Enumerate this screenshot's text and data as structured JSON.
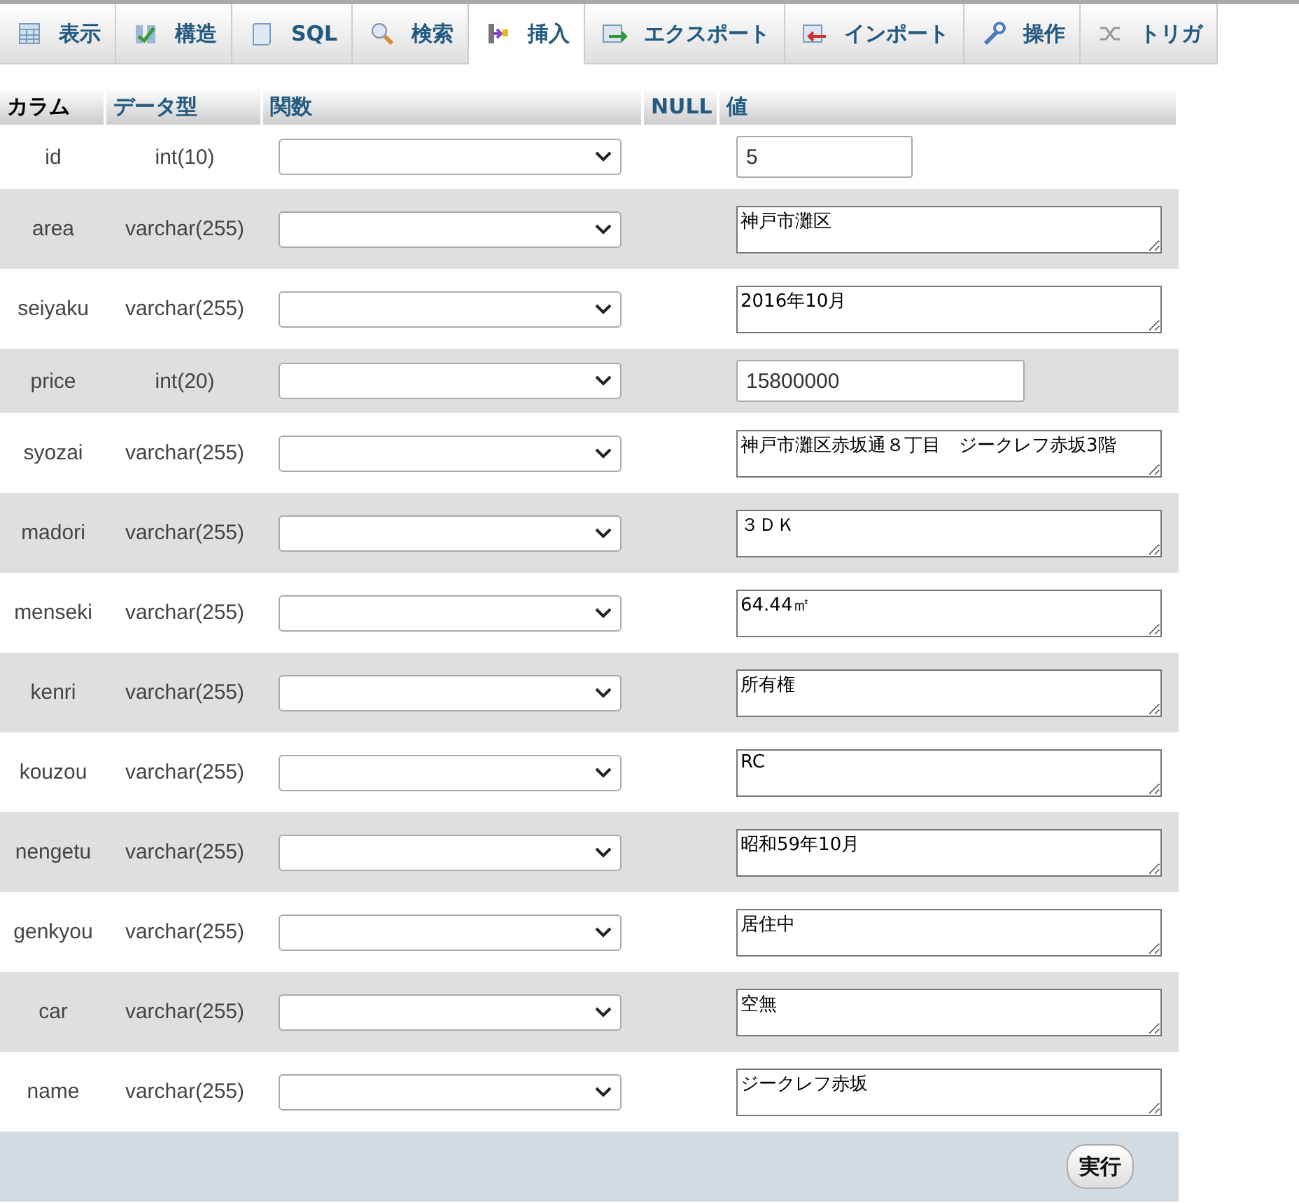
{
  "tabs": [
    {
      "label": "表示",
      "selected": false
    },
    {
      "label": "構造",
      "selected": false
    },
    {
      "label": "SQL",
      "selected": false
    },
    {
      "label": "検索",
      "selected": false
    },
    {
      "label": "挿入",
      "selected": true
    },
    {
      "label": "エクスポート",
      "selected": false
    },
    {
      "label": "インポート",
      "selected": false
    },
    {
      "label": "操作",
      "selected": false
    },
    {
      "label": "トリガ",
      "selected": false
    }
  ],
  "table": {
    "columns": [
      "カラム",
      "データ型",
      "関数",
      "NULL",
      "値"
    ],
    "rows": [
      {
        "column": "id",
        "type": "int(10)",
        "kind": "input",
        "value": "5"
      },
      {
        "column": "area",
        "type": "varchar(255)",
        "kind": "textarea",
        "value": "神戸市灘区"
      },
      {
        "column": "seiyaku",
        "type": "varchar(255)",
        "kind": "textarea",
        "value": "2016年10月"
      },
      {
        "column": "price",
        "type": "int(20)",
        "kind": "input",
        "value": "15800000"
      },
      {
        "column": "syozai",
        "type": "varchar(255)",
        "kind": "textarea",
        "value": "神戸市灘区赤坂通８丁目　ジークレフ赤坂3階"
      },
      {
        "column": "madori",
        "type": "varchar(255)",
        "kind": "textarea",
        "value": "３ＤＫ"
      },
      {
        "column": "menseki",
        "type": "varchar(255)",
        "kind": "textarea",
        "value": "64.44㎡"
      },
      {
        "column": "kenri",
        "type": "varchar(255)",
        "kind": "textarea",
        "value": "所有権"
      },
      {
        "column": "kouzou",
        "type": "varchar(255)",
        "kind": "textarea",
        "value": "RC"
      },
      {
        "column": "nengetu",
        "type": "varchar(255)",
        "kind": "textarea",
        "value": "昭和59年10月"
      },
      {
        "column": "genkyou",
        "type": "varchar(255)",
        "kind": "textarea",
        "value": "居住中"
      },
      {
        "column": "car",
        "type": "varchar(255)",
        "kind": "textarea",
        "value": "空無"
      },
      {
        "column": "name",
        "type": "varchar(255)",
        "kind": "textarea",
        "value": "ジークレフ赤坂"
      }
    ]
  },
  "submit": "実行"
}
